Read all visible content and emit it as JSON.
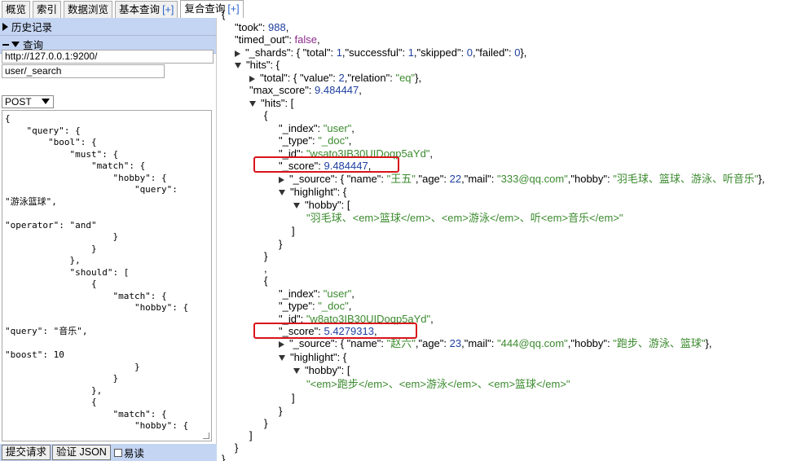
{
  "tabs": [
    {
      "label": "概览"
    },
    {
      "label": "索引"
    },
    {
      "label": "数据浏览"
    },
    {
      "label": "基本查询",
      "plus": "[+]"
    },
    {
      "label": "复合查询",
      "plus": "[+]"
    }
  ],
  "left": {
    "history_label": "历史记录",
    "query_label": "查询",
    "server_url": "http://127.0.0.1:9200/",
    "endpoint": "user/_search",
    "method": "POST",
    "query_body": "{\n    \"query\": {\n        \"bool\": {\n            \"must\": {\n                \"match\": {\n                    \"hobby\": {\n                        \"query\":\n\"游泳篮球\",\n\n\"operator\": \"and\"\n                    }\n                }\n            },\n            \"should\": [\n                {\n                    \"match\": {\n                        \"hobby\": {\n\n\"query\": \"音乐\",\n\n\"boost\": 10\n                        }\n                    }\n                },\n                {\n                    \"match\": {\n                        \"hobby\": {\n\n\"query\": \"跑步\",",
    "submit_label": "提交请求",
    "validate_label": "验证 JSON",
    "easy_read_label": "易读"
  },
  "result": {
    "took": "988",
    "timed_out": "false",
    "shards": {
      "total": "1",
      "successful": "1",
      "skipped": "0",
      "failed": "0"
    },
    "hits_total": {
      "value": "2",
      "relation": "\"eq\""
    },
    "max_score": "9.484447",
    "docs": [
      {
        "index": "\"user\"",
        "type": "\"_doc\"",
        "id": "\"wsato3IB30UIDoqp5aYd\"",
        "score": "9.484447",
        "source": {
          "name": "\"王五\"",
          "age": "22",
          "mail": "\"333@qq.com\"",
          "hobby": "\"羽毛球、篮球、游泳、听音乐\""
        },
        "highlight_hobby": "\"羽毛球、<em>篮球</em>、<em>游泳</em>、听<em>音乐</em>\""
      },
      {
        "index": "\"user\"",
        "type": "\"_doc\"",
        "id": "\"w8ato3IB30UIDoqp5aYd\"",
        "score": "5.4279313",
        "source": {
          "name": "\"赵六\"",
          "age": "23",
          "mail": "\"444@qq.com\"",
          "hobby": "\"跑步、游泳、篮球\""
        },
        "highlight_hobby": "\"<em>跑步</em>、<em>游泳</em>、<em>篮球</em>\""
      }
    ]
  },
  "colors": {
    "string": "#3b8a2e",
    "number": "#1f3f9f",
    "bool": "#8b2a8b",
    "highlight_box": "#d8141a",
    "section_bg": "#c4d5f3"
  }
}
